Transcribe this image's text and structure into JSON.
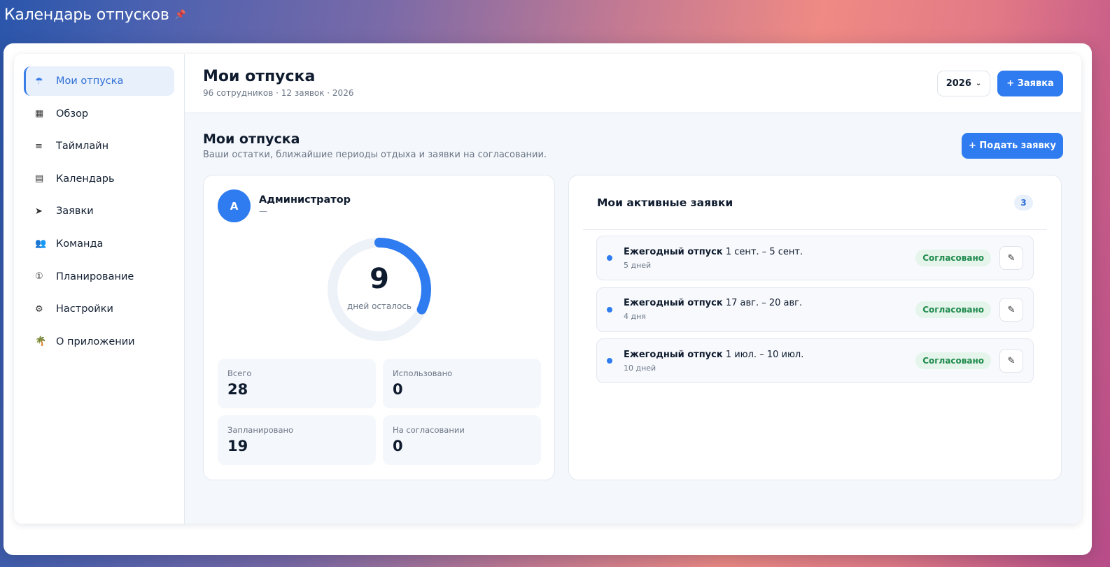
{
  "app": {
    "title": "Календарь отпусков",
    "pin_icon": "pin-icon"
  },
  "sidebar": {
    "items": [
      {
        "icon": "umbrella-icon",
        "glyph": "☂",
        "label": "Мои отпуска",
        "active": true
      },
      {
        "icon": "grid-icon",
        "glyph": "▦",
        "label": "Обзор",
        "active": false
      },
      {
        "icon": "timeline-icon",
        "glyph": "≡",
        "label": "Таймлайн",
        "active": false
      },
      {
        "icon": "calendar-icon",
        "glyph": "▤",
        "label": "Календарь",
        "active": false
      },
      {
        "icon": "send-icon",
        "glyph": "➤",
        "label": "Заявки",
        "active": false
      },
      {
        "icon": "team-icon",
        "glyph": "👥",
        "label": "Команда",
        "active": false
      },
      {
        "icon": "planning-icon",
        "glyph": "①",
        "label": "Планирование",
        "active": false
      },
      {
        "icon": "gear-icon",
        "glyph": "⚙",
        "label": "Настройки",
        "active": false
      },
      {
        "icon": "palm-icon",
        "glyph": "🌴",
        "label": "О приложении",
        "active": false
      }
    ]
  },
  "header": {
    "title": "Мои отпуска",
    "subtitle": "96 сотрудников · 12 заявок · 2026",
    "year_value": "2026",
    "new_request_label": "+ Заявка"
  },
  "section": {
    "title": "Мои отпуска",
    "subtitle": "Ваши остатки, ближайшие периоды отдыха и заявки на согласовании.",
    "submit_label": "+ Подать заявку"
  },
  "profile": {
    "avatar_letter": "А",
    "name": "Администратор",
    "dash": "—",
    "days_left": "9",
    "days_left_label": "дней осталось",
    "ring_fraction": 0.32,
    "stats": [
      {
        "label": "Всего",
        "value": "28"
      },
      {
        "label": "Использовано",
        "value": "0"
      },
      {
        "label": "Запланировано",
        "value": "19"
      },
      {
        "label": "На согласовании",
        "value": "0"
      }
    ]
  },
  "requests": {
    "title": "Мои активные заявки",
    "count": "3",
    "items": [
      {
        "type": "Ежегодный отпуск",
        "period": "1 сент. – 5 сент.",
        "days": "5 дней",
        "status": "Согласовано"
      },
      {
        "type": "Ежегодный отпуск",
        "period": "17 авг. – 20 авг.",
        "days": "4 дня",
        "status": "Согласовано"
      },
      {
        "type": "Ежегодный отпуск",
        "period": "1 июл. – 10 июл.",
        "days": "10 дней",
        "status": "Согласовано"
      }
    ]
  },
  "colors": {
    "accent": "#2f7bf0",
    "success_bg": "#e5f5ec",
    "success_text": "#1f8a4c"
  }
}
